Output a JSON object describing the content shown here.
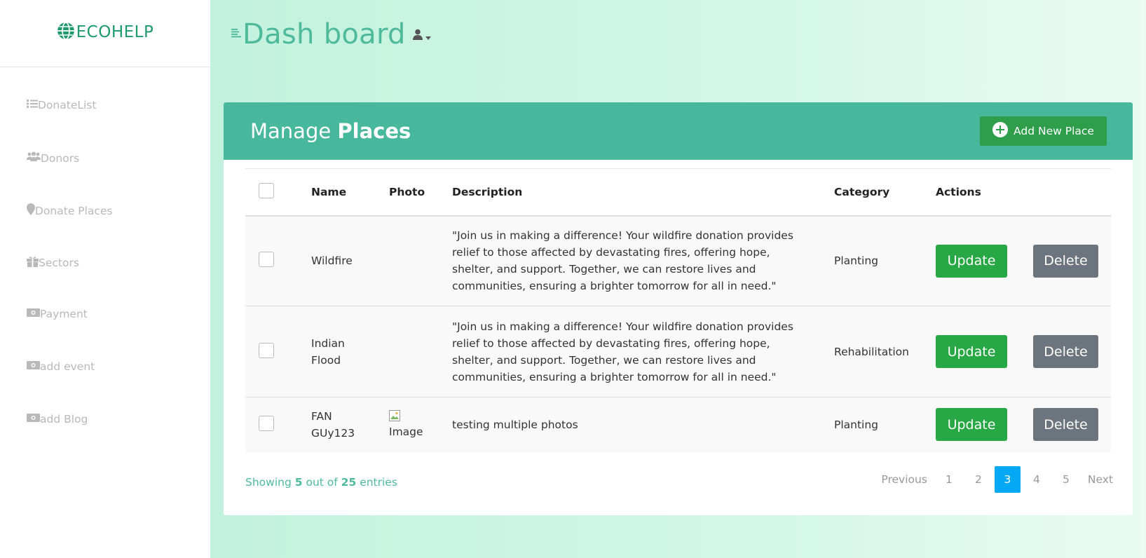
{
  "brand": {
    "name": "ECOHELP",
    "color": "#1f9a6d"
  },
  "sidebar": {
    "items": [
      {
        "label": "DonateList",
        "icon": "list-icon"
      },
      {
        "label": "Donors",
        "icon": "users-icon"
      },
      {
        "label": "Donate Places",
        "icon": "map-marker-icon"
      },
      {
        "label": "Sectors",
        "icon": "gift-icon"
      },
      {
        "label": "Payment",
        "icon": "money-icon"
      },
      {
        "label": "add event",
        "icon": "money-icon"
      },
      {
        "label": "add Blog",
        "icon": "money-icon"
      }
    ]
  },
  "header": {
    "title": "Dash board",
    "menu_icon": "menu-lines-icon",
    "user_icon": "user-icon"
  },
  "card": {
    "title_light": "Manage",
    "title_bold": "Places",
    "add_button": "Add New Place"
  },
  "table": {
    "columns": [
      "Name",
      "Photo",
      "Description",
      "Category",
      "Actions"
    ],
    "rows": [
      {
        "name": "Wildfire",
        "photo": "",
        "description": "\"Join us in making a difference! Your wildfire donation provides relief to those affected by devastating fires, offering hope, shelter, and support. Together, we can restore lives and communities, ensuring a brighter tomorrow for all in need.\"",
        "category": "Planting",
        "update": "Update",
        "delete": "Delete"
      },
      {
        "name": "Indian Flood",
        "photo": "",
        "description": "\"Join us in making a difference! Your wildfire donation provides relief to those affected by devastating fires, offering hope, shelter, and support. Together, we can restore lives and communities, ensuring a brighter tomorrow for all in need.\"",
        "category": "Rehabilitation",
        "update": "Update",
        "delete": "Delete"
      },
      {
        "name": "FAN GUy123",
        "photo": "Image",
        "description": "testing multiple photos",
        "category": "Planting",
        "update": "Update",
        "delete": "Delete"
      }
    ]
  },
  "footer": {
    "prefix": "Showing",
    "shown": "5",
    "middle": "out of",
    "total": "25",
    "suffix": "entries"
  },
  "pagination": {
    "previous": "Previous",
    "pages": [
      "1",
      "2",
      "3",
      "4",
      "5"
    ],
    "active": "3",
    "next": "Next"
  },
  "colors": {
    "header_bg": "#48b89c",
    "update": "#28a745",
    "delete": "#6c757d",
    "active_page": "#03a9f4",
    "add_button": "#2e9e4b"
  }
}
